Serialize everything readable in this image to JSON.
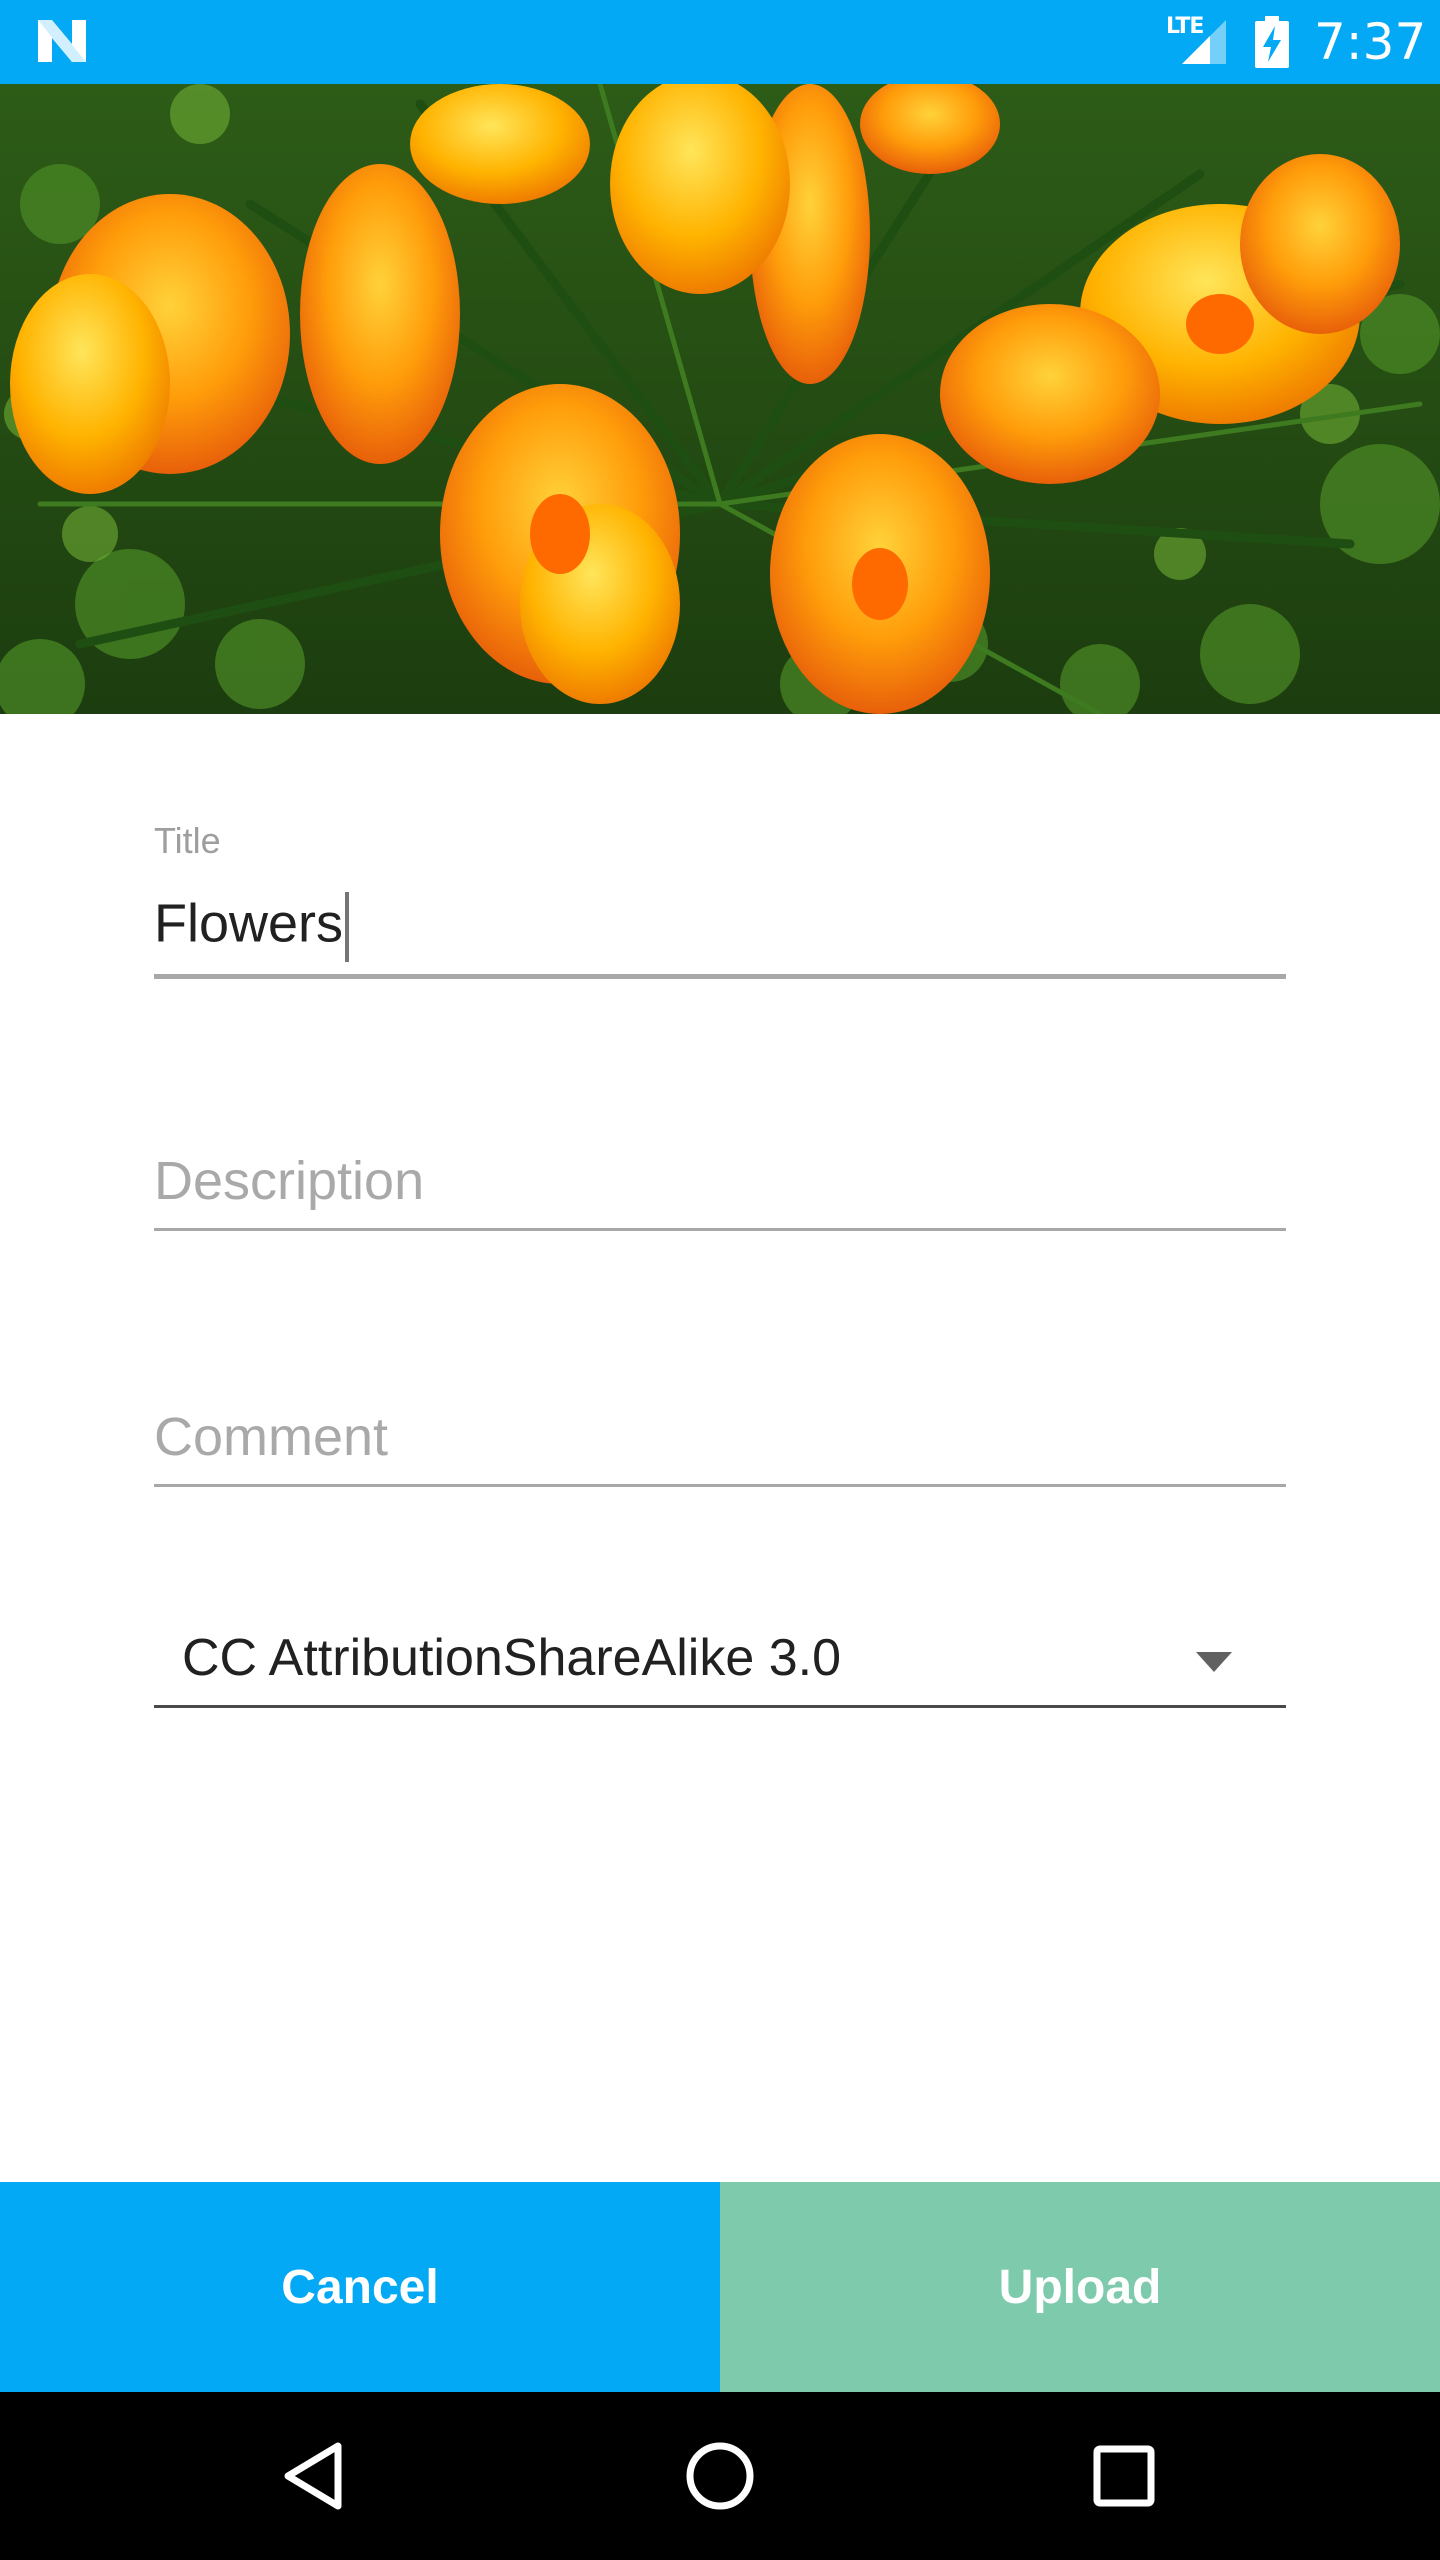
{
  "status_bar": {
    "network": "LTE",
    "time": "7:37",
    "icons": [
      "n-logo-icon",
      "signal-lte-icon",
      "battery-charging-icon"
    ]
  },
  "form": {
    "title_label": "Title",
    "title_value": "Flowers",
    "description_placeholder": "Description",
    "comment_placeholder": "Comment",
    "license_selected": "CC AttributionShareAlike 3.0"
  },
  "buttons": {
    "cancel_label": "Cancel",
    "upload_label": "Upload"
  },
  "colors": {
    "primary": "#03a9f4",
    "upload_button": "#7dcaad",
    "nav_bar": "#000000"
  },
  "nav_bar": {
    "icons": [
      "back-icon",
      "home-icon",
      "recents-icon"
    ]
  }
}
